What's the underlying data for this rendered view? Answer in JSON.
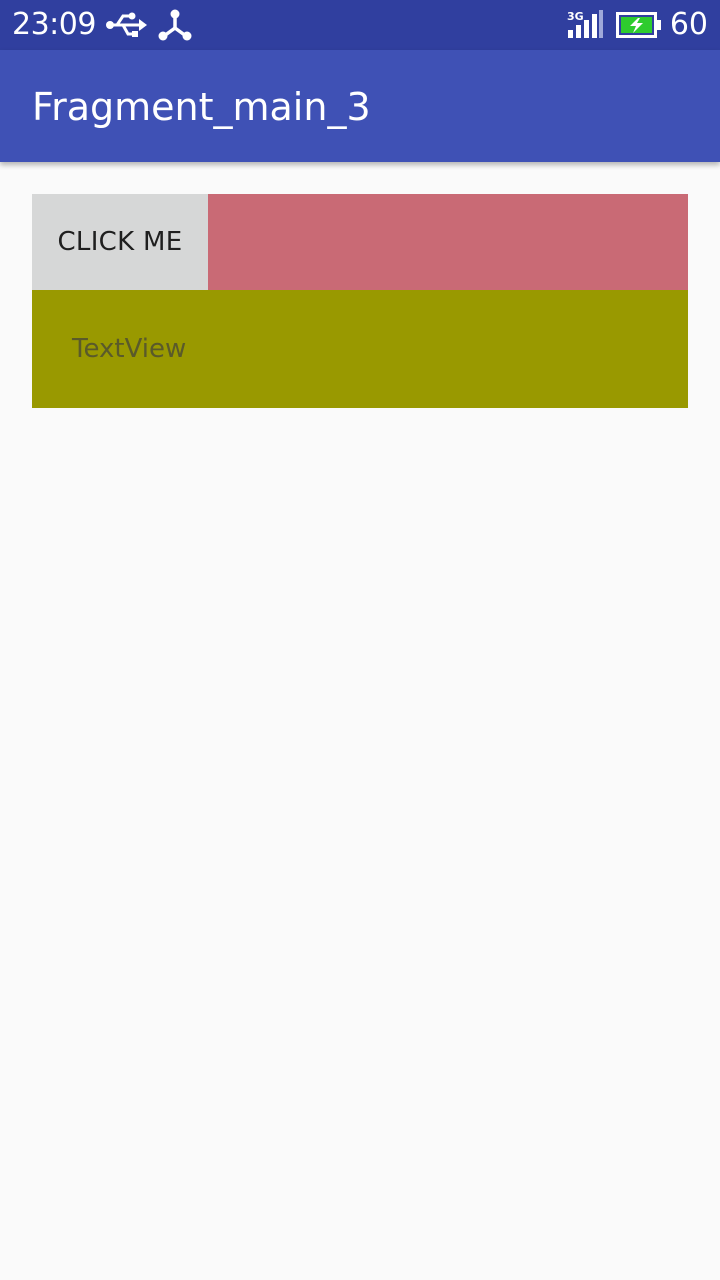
{
  "status_bar": {
    "time": "23:09",
    "network_type": "3G",
    "battery_level": "60",
    "icons": [
      "usb-icon",
      "share-icon",
      "signal-icon",
      "battery-charging-icon"
    ]
  },
  "app_bar": {
    "title": "Fragment_main_3"
  },
  "main": {
    "button_label": "CLICK ME",
    "text_view": "TextView"
  },
  "colors": {
    "status_bar": "#303f9f",
    "app_bar": "#3f51b5",
    "button_background": "#d6d7d7",
    "pink_block": "#c96a75",
    "olive_block": "#999900",
    "page_background": "#fafafa",
    "battery_fill": "#2ecc2e"
  }
}
